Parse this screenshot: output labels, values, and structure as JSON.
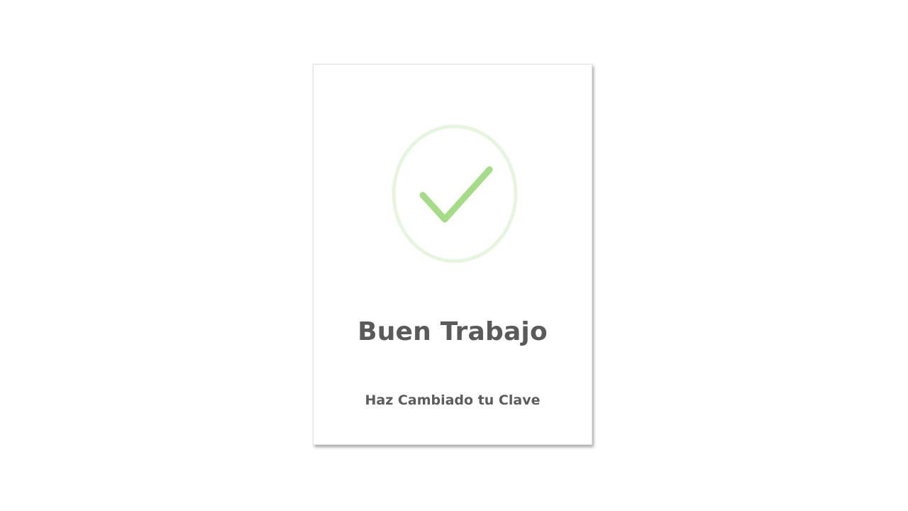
{
  "dialog": {
    "title": "Buen Trabajo",
    "message": "Haz Cambiado tu Clave",
    "icon": "success-check-icon",
    "colors": {
      "check": "#a5dc86",
      "ring": "#e6f6de",
      "text": "#5a5a5a"
    }
  }
}
